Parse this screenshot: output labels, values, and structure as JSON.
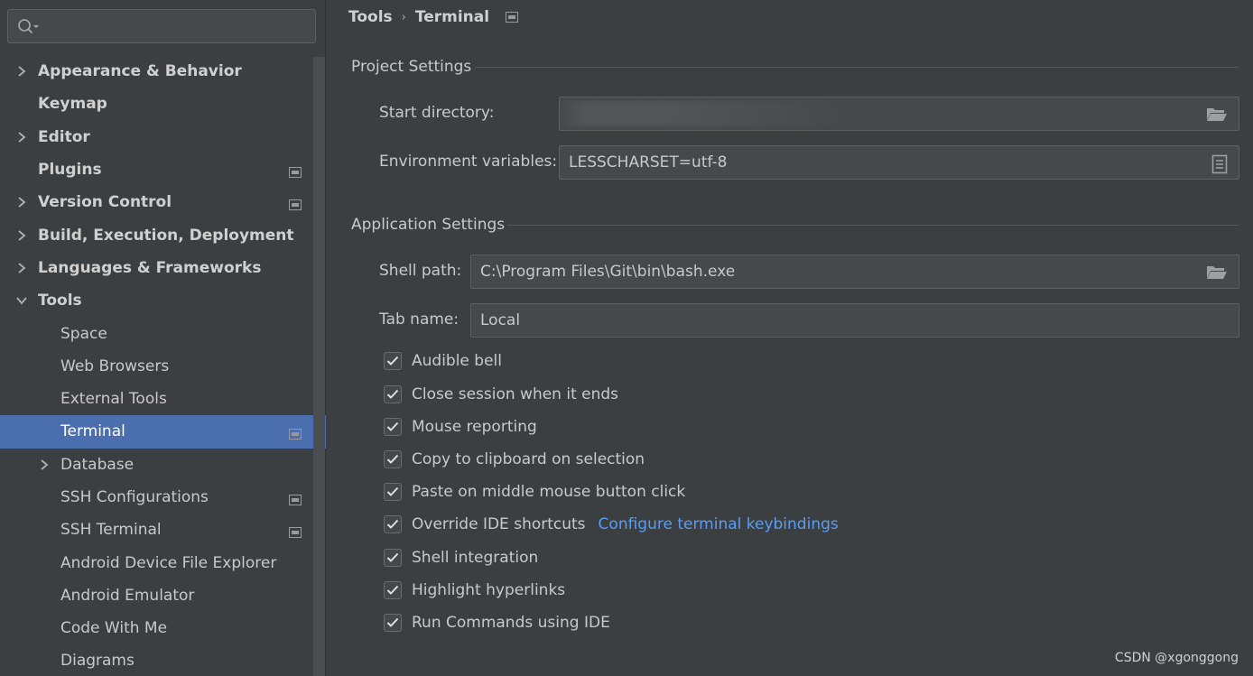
{
  "sidebar": {
    "search": {
      "placeholder": ""
    },
    "items": [
      {
        "label": "Appearance & Behavior",
        "level": 0,
        "expandable": true,
        "expanded": false,
        "bold": true,
        "project_icon": false,
        "selected": false
      },
      {
        "label": "Keymap",
        "level": 0,
        "expandable": false,
        "bold": true,
        "project_icon": false,
        "selected": false
      },
      {
        "label": "Editor",
        "level": 0,
        "expandable": true,
        "expanded": false,
        "bold": true,
        "project_icon": false,
        "selected": false
      },
      {
        "label": "Plugins",
        "level": 0,
        "expandable": false,
        "bold": true,
        "project_icon": true,
        "selected": false
      },
      {
        "label": "Version Control",
        "level": 0,
        "expandable": true,
        "expanded": false,
        "bold": true,
        "project_icon": true,
        "selected": false
      },
      {
        "label": "Build, Execution, Deployment",
        "level": 0,
        "expandable": true,
        "expanded": false,
        "bold": true,
        "project_icon": false,
        "selected": false
      },
      {
        "label": "Languages & Frameworks",
        "level": 0,
        "expandable": true,
        "expanded": false,
        "bold": true,
        "project_icon": false,
        "selected": false
      },
      {
        "label": "Tools",
        "level": 0,
        "expandable": true,
        "expanded": true,
        "bold": true,
        "project_icon": false,
        "selected": false
      },
      {
        "label": "Space",
        "level": 1,
        "expandable": false,
        "bold": false,
        "project_icon": false,
        "selected": false
      },
      {
        "label": "Web Browsers",
        "level": 1,
        "expandable": false,
        "bold": false,
        "project_icon": false,
        "selected": false
      },
      {
        "label": "External Tools",
        "level": 1,
        "expandable": false,
        "bold": false,
        "project_icon": false,
        "selected": false
      },
      {
        "label": "Terminal",
        "level": 1,
        "expandable": false,
        "bold": false,
        "project_icon": true,
        "selected": true
      },
      {
        "label": "Database",
        "level": 1,
        "expandable": true,
        "expanded": false,
        "bold": false,
        "project_icon": false,
        "selected": false
      },
      {
        "label": "SSH Configurations",
        "level": 1,
        "expandable": false,
        "bold": false,
        "project_icon": true,
        "selected": false
      },
      {
        "label": "SSH Terminal",
        "level": 1,
        "expandable": false,
        "bold": false,
        "project_icon": true,
        "selected": false
      },
      {
        "label": "Android Device File Explorer",
        "level": 1,
        "expandable": false,
        "bold": false,
        "project_icon": false,
        "selected": false
      },
      {
        "label": "Android Emulator",
        "level": 1,
        "expandable": false,
        "bold": false,
        "project_icon": false,
        "selected": false
      },
      {
        "label": "Code With Me",
        "level": 1,
        "expandable": false,
        "bold": false,
        "project_icon": false,
        "selected": false
      },
      {
        "label": "Diagrams",
        "level": 1,
        "expandable": false,
        "bold": false,
        "project_icon": false,
        "selected": false
      }
    ]
  },
  "breadcrumb": {
    "parent": "Tools",
    "current": "Terminal"
  },
  "project_settings": {
    "title": "Project Settings",
    "start_directory_label": "Start directory:",
    "start_directory_value": "",
    "env_vars_label": "Environment variables:",
    "env_vars_value": "LESSCHARSET=utf-8"
  },
  "application_settings": {
    "title": "Application Settings",
    "shell_path_label": "Shell path:",
    "shell_path_value": "C:\\Program Files\\Git\\bin\\bash.exe",
    "tab_name_label": "Tab name:",
    "tab_name_value": "Local",
    "checkboxes": [
      {
        "label": "Audible bell",
        "checked": true
      },
      {
        "label": "Close session when it ends",
        "checked": true
      },
      {
        "label": "Mouse reporting",
        "checked": true
      },
      {
        "label": "Copy to clipboard on selection",
        "checked": true
      },
      {
        "label": "Paste on middle mouse button click",
        "checked": true
      },
      {
        "label": "Override IDE shortcuts",
        "checked": true,
        "link": "Configure terminal keybindings"
      },
      {
        "label": "Shell integration",
        "checked": true
      },
      {
        "label": "Highlight hyperlinks",
        "checked": true
      },
      {
        "label": "Run Commands using IDE",
        "checked": true
      }
    ]
  },
  "watermark": "CSDN @xgonggong",
  "colors": {
    "selection": "#4b6eaf",
    "link": "#589df6",
    "background": "#3c3f41"
  }
}
